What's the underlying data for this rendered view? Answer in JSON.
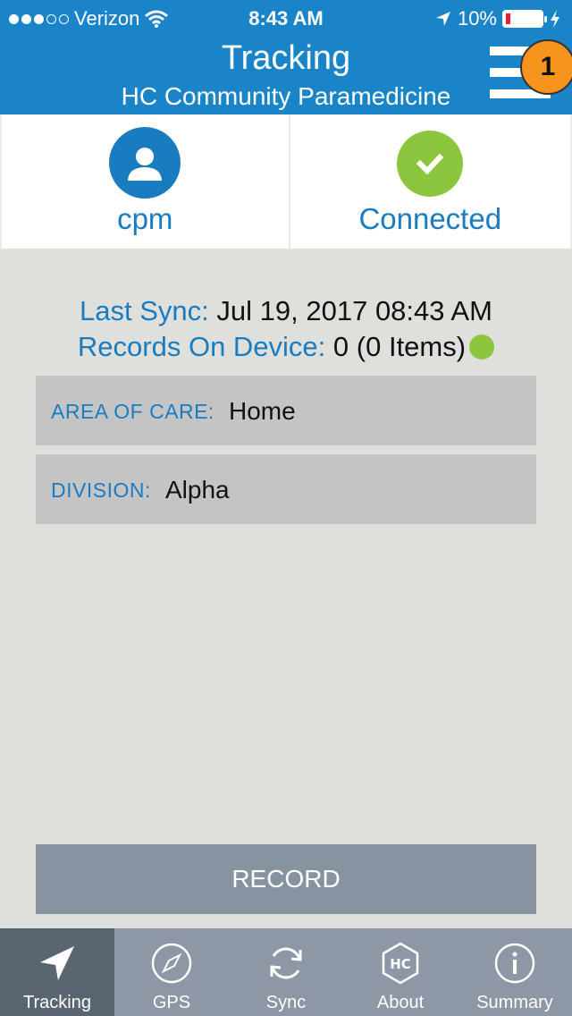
{
  "status_bar": {
    "carrier": "Verizon",
    "time": "8:43 AM",
    "battery": "10%",
    "signal_bars_filled": 3,
    "signal_bars_total": 5
  },
  "header": {
    "title": "Tracking",
    "subtitle": "HC Community Paramedicine",
    "badge": "1"
  },
  "panels": {
    "user": {
      "label": "cpm",
      "icon": "user-icon",
      "color": "#1a7cc0"
    },
    "connection": {
      "label": "Connected",
      "icon": "check-icon",
      "color": "#8cc63f"
    }
  },
  "sync": {
    "last_sync_label": "Last Sync:",
    "last_sync_value": "Jul 19, 2017 08:43 AM",
    "records_label": "Records On Device:",
    "records_value": "0 (0 Items)"
  },
  "fields": {
    "area_label": "AREA OF CARE:",
    "area_value": "Home",
    "division_label": "DIVISION:",
    "division_value": "Alpha"
  },
  "record_button": "RECORD",
  "tabs": [
    {
      "label": "Tracking",
      "icon": "navigation-arrow-icon",
      "active": true
    },
    {
      "label": "GPS",
      "icon": "compass-icon",
      "active": false
    },
    {
      "label": "Sync",
      "icon": "sync-icon",
      "active": false
    },
    {
      "label": "About",
      "icon": "hc-logo-icon",
      "active": false
    },
    {
      "label": "Summary",
      "icon": "info-icon",
      "active": false
    }
  ],
  "colors": {
    "header_blue": "#1a84c8",
    "accent_blue": "#1a7cc0",
    "status_green": "#8cc63f",
    "badge_orange": "#f7941d",
    "tabbar": "#8d97a5",
    "tab_active": "#5a6572"
  }
}
